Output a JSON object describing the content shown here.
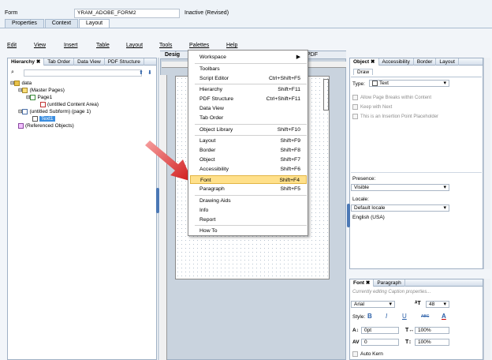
{
  "header": {
    "form_label": "Form",
    "form_value": "YRAM_ADOBE_FORM2",
    "status": "Inactive (Revised)",
    "tabs": [
      "Properties",
      "Context",
      "Layout"
    ]
  },
  "menubar": [
    "Edit",
    "View",
    "Insert",
    "Table",
    "Layout",
    "Tools",
    "Palettes",
    "Help"
  ],
  "left_panel": {
    "tabs": [
      "Hierarchy",
      "Tab Order",
      "Data View",
      "PDF Structure"
    ],
    "tree": [
      "data",
      "(Master Pages)",
      "Page1",
      "(untitled Content Area)",
      "(untitled Subform) (page 1)",
      "Text1",
      "(Referenced Objects)"
    ]
  },
  "design": {
    "tab_partial": "Desig",
    "tab_pdf": "PDF"
  },
  "context_menu": {
    "items": [
      {
        "label": "Workspace",
        "shortcut": "▶"
      },
      {
        "label": "Toolbars",
        "shortcut": ""
      },
      {
        "label": "Script Editor",
        "shortcut": "Ctrl+Shift+F5"
      },
      {
        "label": "Hierarchy",
        "shortcut": "Shift+F11"
      },
      {
        "label": "PDF Structure",
        "shortcut": "Ctrl+Shift+F11"
      },
      {
        "label": "Data View",
        "shortcut": ""
      },
      {
        "label": "Tab Order",
        "shortcut": ""
      },
      {
        "label": "Object Library",
        "shortcut": "Shift+F10"
      },
      {
        "label": "Layout",
        "shortcut": "Shift+F9"
      },
      {
        "label": "Border",
        "shortcut": "Shift+F8"
      },
      {
        "label": "Object",
        "shortcut": "Shift+F7"
      },
      {
        "label": "Accessibility",
        "shortcut": "Shift+F6"
      },
      {
        "label": "Font",
        "shortcut": "Shift+F4"
      },
      {
        "label": "Paragraph",
        "shortcut": "Shift+F5"
      },
      {
        "label": "Drawing Aids",
        "shortcut": ""
      },
      {
        "label": "Info",
        "shortcut": ""
      },
      {
        "label": "Report",
        "shortcut": ""
      },
      {
        "label": "How To",
        "shortcut": ""
      }
    ]
  },
  "object_panel": {
    "tabs": [
      "Object",
      "Accessibility",
      "Border",
      "Layout"
    ],
    "subtab": "Draw",
    "type_label": "Type:",
    "type_value": "Text",
    "checks": [
      "Allow Page Breaks within Content",
      "Keep with Next",
      "This is an Insertion Point Placeholder"
    ],
    "presence_label": "Presence:",
    "presence_value": "Visible",
    "locale_label": "Locale:",
    "locale_value": "Default locale",
    "locale_sub": "English (USA)"
  },
  "font_panel": {
    "tabs": [
      "Font",
      "Paragraph"
    ],
    "caption_note": "Currently editing Caption properties...",
    "font_value": "Arial",
    "size_value": "48",
    "style_label": "Style:",
    "style_buttons": [
      "B",
      "I",
      "U",
      "ABC",
      "A"
    ],
    "baseline_value": "0pt",
    "scale_h": "100%",
    "spacing_value": "0",
    "scale_v": "100%",
    "autokern": "Auto Kern"
  },
  "colors": {
    "highlight": "#ffe08a",
    "arrow": "#e02020",
    "selected_node": "#3b8ee0"
  }
}
